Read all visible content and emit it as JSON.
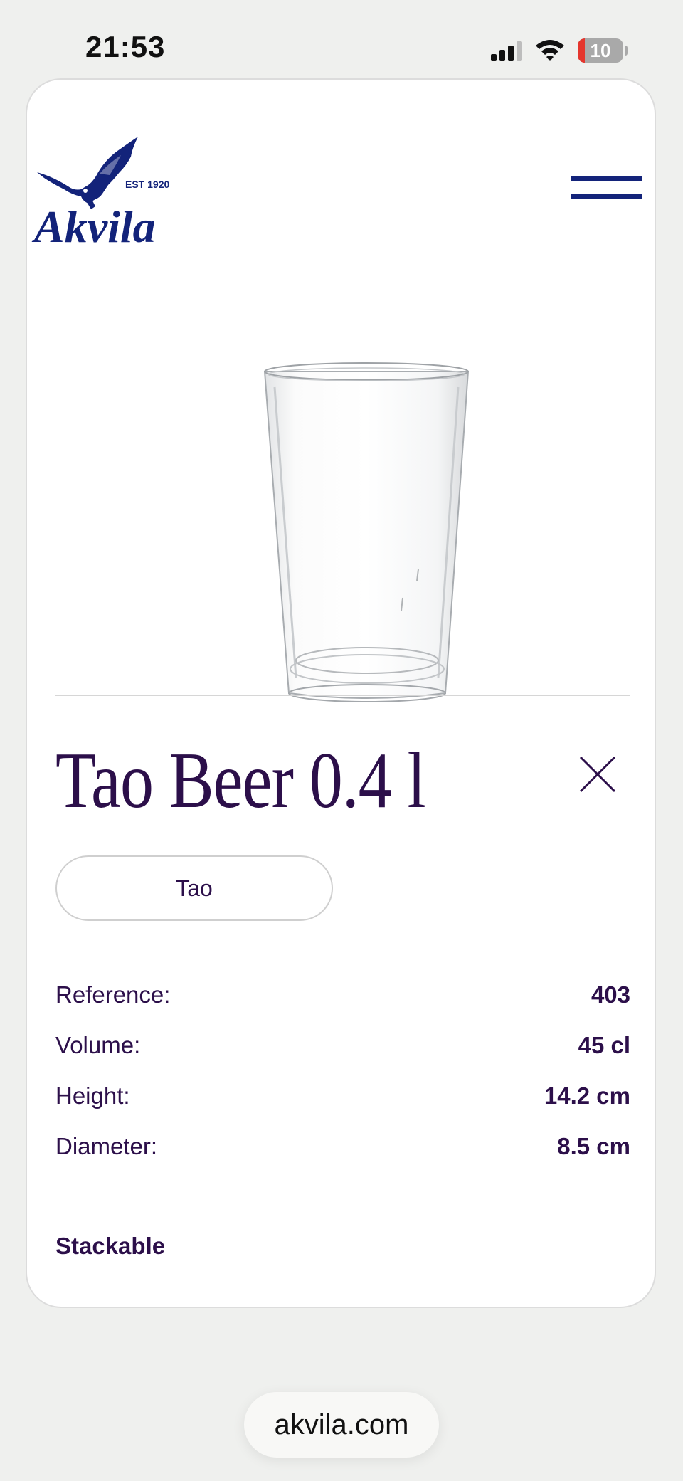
{
  "status_bar": {
    "time": "21:53",
    "battery_level": "10",
    "icons": [
      "signal-icon",
      "wifi-icon",
      "battery-icon"
    ]
  },
  "header": {
    "logo_text": "Akvila",
    "logo_est": "EST 1920",
    "menu_icon": "hamburger-menu-icon"
  },
  "product": {
    "image": "pint-glass-image",
    "title": "Tao Beer 0.4 l",
    "collection": "Tao",
    "specs": [
      {
        "label": "Reference:",
        "value": "403"
      },
      {
        "label": "Volume:",
        "value": "45 cl"
      },
      {
        "label": "Height:",
        "value": "14.2 cm"
      },
      {
        "label": "Diameter:",
        "value": "8.5 cm"
      }
    ],
    "feature": "Stackable"
  },
  "browser": {
    "url": "akvila.com"
  },
  "colors": {
    "brand_navy": "#13237a",
    "text_purple": "#2c0f4a",
    "battery_low": "#e5362d"
  }
}
